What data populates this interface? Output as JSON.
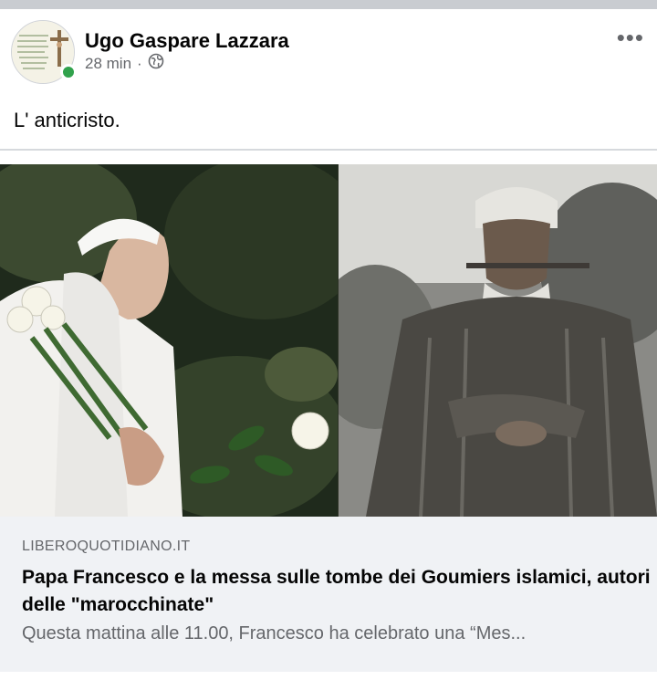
{
  "post": {
    "author": "Ugo Gaspare Lazzara",
    "time": "28 min",
    "separator": "·",
    "privacy_icon": "globe-icon",
    "more_icon": "more-options-icon",
    "text": "L' anticristo."
  },
  "link_preview": {
    "domain": "LIBEROQUOTIDIANO.IT",
    "headline": "Papa Francesco e la messa sulle tombe dei Goumiers islamici, autori delle \"marocchinate\"",
    "description": "Questa mattina alle 11.00, Francesco ha celebrato una “Mes..."
  },
  "colors": {
    "online": "#31a24c",
    "secondary_text": "#65676b",
    "card_bg": "#f0f2f5"
  }
}
